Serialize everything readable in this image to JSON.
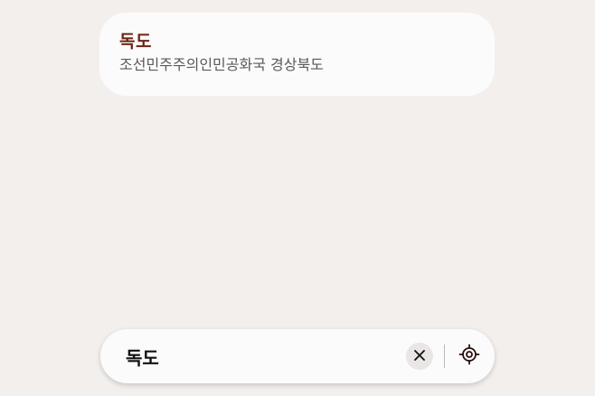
{
  "result": {
    "title": "독도",
    "subtitle": "조선민주주의인민공화국 경상북도"
  },
  "search": {
    "value": "독도"
  },
  "icons": {
    "clear": "close-icon",
    "locate": "my-location-icon"
  },
  "colors": {
    "title": "#6b2516",
    "background": "#f3efed",
    "card": "#fcfbfb"
  }
}
